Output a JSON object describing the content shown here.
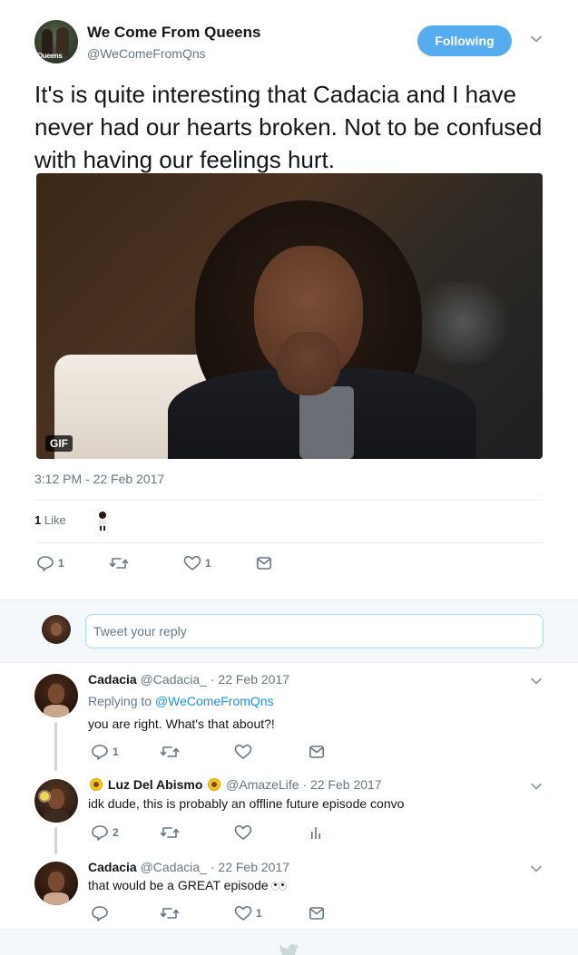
{
  "tweet": {
    "author_name": "We Come From Queens",
    "author_handle": "@WeComeFromQns",
    "avatar_logo_text": "Queens",
    "follow_label": "Following",
    "text": "It's is quite interesting that Cadacia and I have never had our hearts broken. Not to be confused with having our feelings hurt.",
    "media_badge": "GIF",
    "timestamp": "3:12 PM - 22 Feb 2017",
    "likes_count": "1",
    "likes_label": "Like",
    "actions": {
      "reply_count": "1",
      "retweet_count": "",
      "like_count": "1"
    }
  },
  "composer": {
    "placeholder": "Tweet your reply"
  },
  "replies": [
    {
      "name": "Cadacia",
      "handle": "@Cadacia_",
      "date": "· 22 Feb 2017",
      "replying_prefix": "Replying to ",
      "replying_to": "@WeComeFromQns",
      "text": "you are right. What's that about?!",
      "reply_count": "1",
      "retweet_count": "",
      "like_count": ""
    },
    {
      "name": "Luz Del Abismo",
      "handle": "@AmazeLife",
      "date": "· 22 Feb 2017",
      "text": "idk dude, this is probably an offline future episode convo",
      "reply_count": "2",
      "retweet_count": "",
      "like_count": ""
    },
    {
      "name": "Cadacia",
      "handle": "@Cadacia_",
      "date": "· 22 Feb 2017",
      "text": "that would be a GREAT episode",
      "reply_count": "",
      "retweet_count": "",
      "like_count": "1"
    }
  ],
  "icons": {
    "reply": "reply-icon",
    "retweet": "retweet-icon",
    "like": "heart-icon",
    "dm": "envelope-icon",
    "analytics": "analytics-icon",
    "caret": "chevron-down-icon",
    "footer": "bird-icon"
  },
  "colors": {
    "accent": "#1b95e0",
    "follow_button": "#55acee",
    "secondary_text": "#657786",
    "icon": "#657786",
    "divider": "#e6ecf0"
  }
}
